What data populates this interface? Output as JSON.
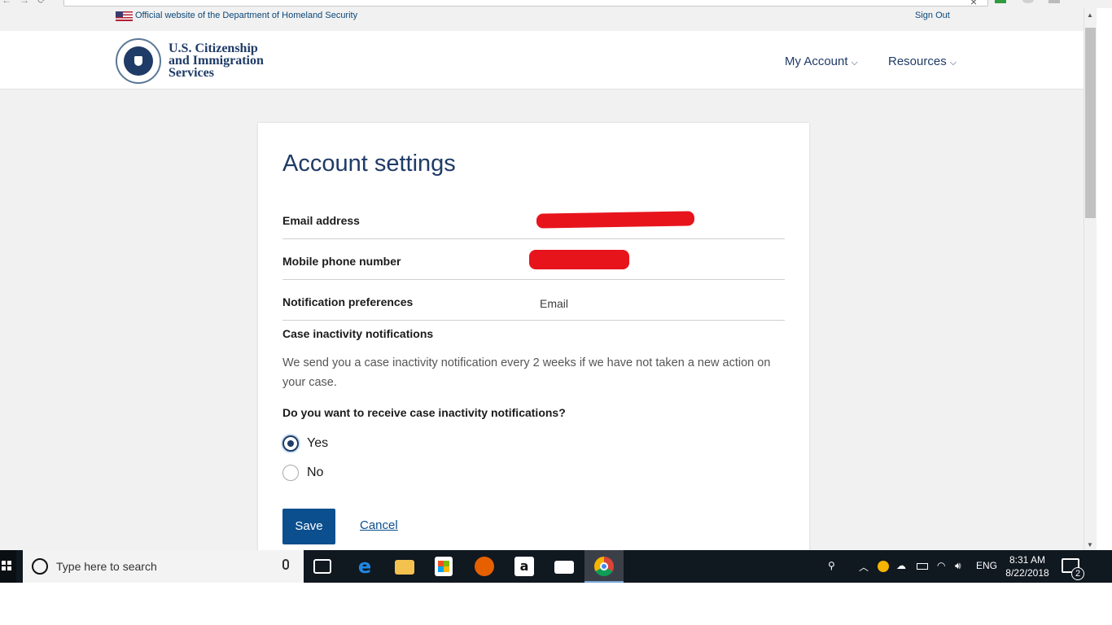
{
  "gov_banner": {
    "official_text": "Official website of the Department of Homeland Security",
    "sign_out": "Sign Out"
  },
  "header": {
    "agency_line1": "U.S. Citizenship",
    "agency_line2": "and Immigration",
    "agency_line3": "Services",
    "nav": [
      {
        "label": "My Account"
      },
      {
        "label": "Resources"
      }
    ]
  },
  "account": {
    "title": "Account settings",
    "rows": [
      {
        "label": "Email address",
        "value": ""
      },
      {
        "label": "Mobile phone number",
        "value": ""
      },
      {
        "label": "Notification preferences",
        "value": "Email"
      }
    ],
    "inactivity_title": "Case inactivity notifications",
    "inactivity_desc": "We send you a case inactivity notification every 2 weeks if we have not taken a new action on your case.",
    "question": "Do you want to receive case inactivity notifications?",
    "options": [
      {
        "label": "Yes",
        "selected": true
      },
      {
        "label": "No",
        "selected": false
      }
    ],
    "save_label": "Save",
    "cancel_label": "Cancel"
  },
  "taskbar": {
    "search_placeholder": "Type here to search",
    "language": "ENG",
    "time": "8:31 AM",
    "date": "8/22/2018",
    "notification_count": "2",
    "apps": [
      "task-view-icon",
      "edge-icon",
      "file-explorer-icon",
      "store-icon",
      "firefox-icon",
      "amazon-icon",
      "mail-icon",
      "chrome-icon"
    ]
  },
  "colors": {
    "brand_navy": "#1f3b67",
    "button_blue": "#0b4f8e",
    "redaction": "#e8141c"
  }
}
